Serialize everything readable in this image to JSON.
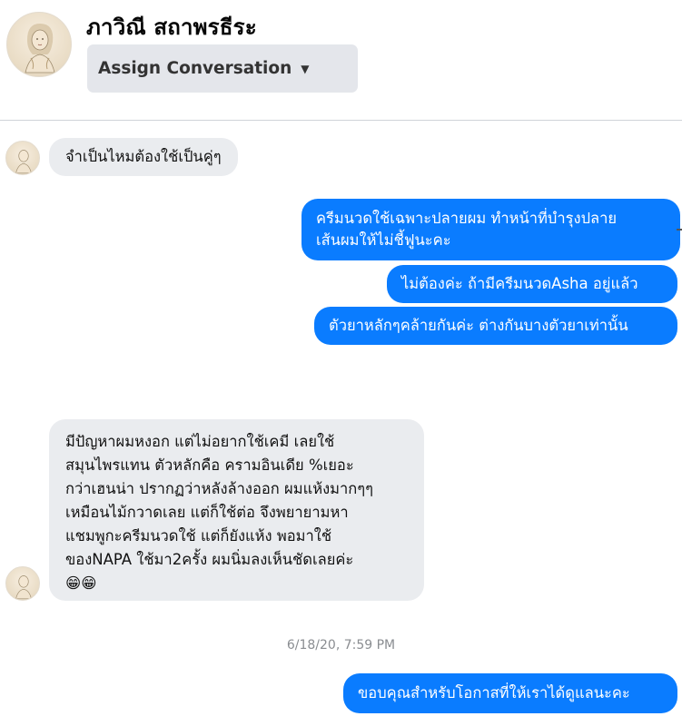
{
  "header": {
    "contact_name": "ภาวิณี สถาพรธีระ",
    "assign_label": "Assign Conversation"
  },
  "icons": {
    "avatar": "avatar-illustration",
    "assign_caret": "caret-down-icon"
  },
  "messages": [
    {
      "direction": "incoming",
      "text": "จำเป็นไหมต้องใช้เป็นคู่ๆ"
    },
    {
      "direction": "outgoing",
      "text": "ครีมนวดใช้เฉพาะปลายผม ทำหน้าที่บำรุงปลาย\nเส้นผมให้ไม่ชี้ฟูนะคะ"
    },
    {
      "direction": "outgoing",
      "text": "ไม่ต้องค่ะ ถ้ามีครีมนวดAsha อยู่แล้ว"
    },
    {
      "direction": "outgoing",
      "text": "ตัวยาหลักๆคล้ายกันค่ะ ต่างกันบางตัวยาเท่านั้น"
    },
    {
      "direction": "incoming",
      "text": "มีปัญหาผมหงอก แต่ไม่อยากใช้เคมี เลยใช้\nสมุนไพรแทน ตัวหลักคือ ครามอินเดีย %เยอะ\nกว่าเฮนน่า ปรากฏว่าหลังล้างออก ผมแห้งมากๆๆ\nเหมือนไม้กวาดเลย แต่ก็ใช้ต่อ  จึงพยายามหา\nแชมพูกะครีมนวดใช้ แต่ก็ยังแห้ง พอมาใช้\nของNAPA ใช้มา2ครั้ง ผมนิ่มลงเห็นชัดเลยค่ะ\n😁😁"
    },
    {
      "direction": "outgoing",
      "text": "ขอบคุณสำหรับโอกาสที่ให้เราได้ดูแลนะคะ"
    }
  ],
  "timestamp": "6/18/20, 7:59 PM",
  "colors": {
    "outgoing_bubble": "#0a7cff",
    "incoming_bubble": "#eaecef",
    "assign_button": "#e4e6eb"
  }
}
